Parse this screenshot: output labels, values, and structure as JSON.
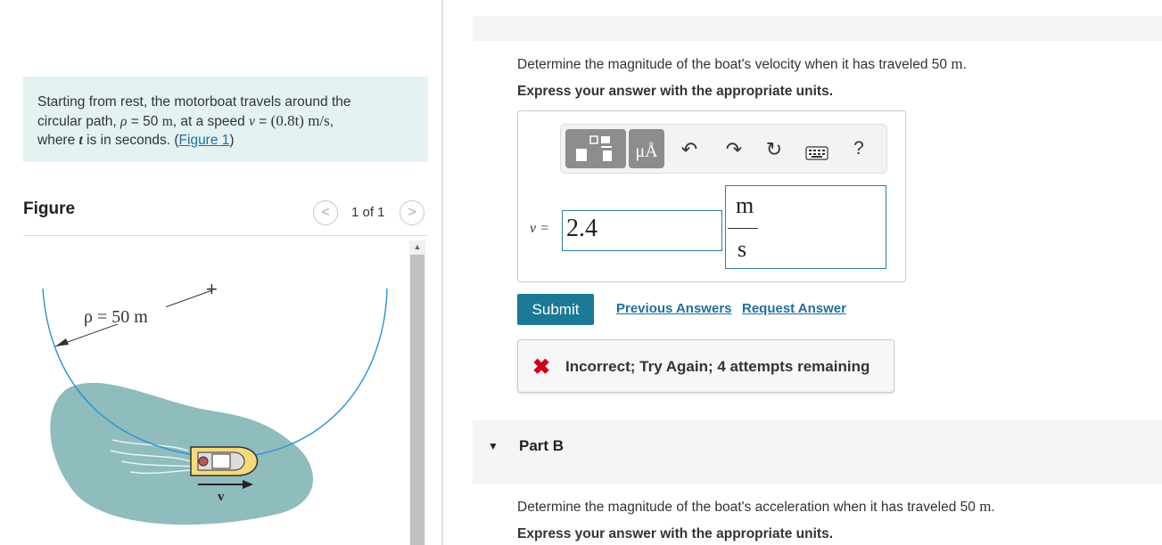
{
  "problem": {
    "line1": "Starting from rest, the motorboat travels around the",
    "line2_pre": "circular path, ",
    "line2_rho": "ρ",
    "line2_mid": " = 50 ",
    "line2_m": "m",
    "line2_comma1": ", at a speed ",
    "line2_v": "v",
    "line2_eq": " = ",
    "line2_expr": "(0.8t) m/s",
    "line2_comma2": ",",
    "line3_pre": "where ",
    "line3_t": "t",
    "line3_post": " is in seconds. (",
    "figure_link": "Figure 1",
    "line3_close": ")"
  },
  "figure_panel": {
    "heading": "Figure",
    "prev_icon": "chevron-left-icon",
    "next_icon": "chevron-right-icon",
    "prev_glyph": "<",
    "next_glyph": ">",
    "page_indicator": "1 of 1",
    "rho_label": "ρ = 50 m",
    "velocity_label": "v",
    "center_mark": "+"
  },
  "part_a": {
    "question_pre": "Determine the magnitude of the boat's velocity when it has traveled 50 ",
    "question_unit": "m",
    "question_post": ".",
    "instruction": "Express your answer with the appropriate units.",
    "toolbar": {
      "templates_icon": "fraction-template-icon",
      "units_icon": "units-muA-icon",
      "units_glyph": "μÅ",
      "undo_icon": "undo-icon",
      "undo_glyph": "↶",
      "redo_icon": "redo-icon",
      "redo_glyph": "↷",
      "reset_icon": "reset-icon",
      "reset_glyph": "↻",
      "keyboard_icon": "keyboard-icon",
      "help_glyph": "?"
    },
    "variable_label": "v =",
    "value": "2.4",
    "unit_numerator": "m",
    "unit_denominator": "s",
    "submit_label": "Submit",
    "previous_answers_label": "Previous Answers",
    "request_answer_label": "Request Answer",
    "feedback_icon": "close-x-icon",
    "feedback_glyph": "✖",
    "feedback_text": "Incorrect; Try Again; 4 attempts remaining"
  },
  "part_b": {
    "label": "Part B",
    "caret_glyph": "▼",
    "question_pre": "Determine the magnitude of the boat's acceleration when it has traveled 50 ",
    "question_unit": "m",
    "question_post": ".",
    "instruction": "Express your answer with the appropriate units."
  },
  "colors": {
    "problem_bg": "#e4f2f2",
    "submit_bg": "#1a7a95",
    "link": "#1f6f9f",
    "error": "#d0021b",
    "water": "#8fbcbc",
    "path_arc": "#2b8fd6"
  }
}
